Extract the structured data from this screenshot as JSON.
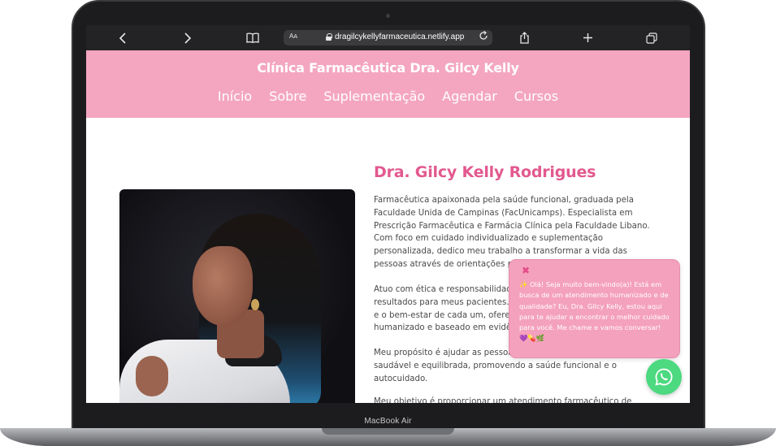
{
  "browser": {
    "text_size_label": "AA",
    "url": "dragilcykellyfarmaceutica.netlify.app"
  },
  "site": {
    "title": "Clínica Farmacêutica Dra. Gilcy Kelly",
    "nav": [
      "Início",
      "Sobre",
      "Suplementação",
      "Agendar",
      "Cursos"
    ],
    "accent_color": "#f4a6c0",
    "heading_color": "#e2598f"
  },
  "about": {
    "name": "Dra. Gilcy Kelly Rodrigues",
    "paragraphs": [
      "Farmacêutica apaixonada pela saúde funcional, graduada pela Faculdade Unida de Campinas (FacUnicamps). Especialista em Prescrição Farmacêutica e Farmácia Clínica pela Faculdade Libano. Com foco em cuidado individualizado e suplementação personalizada, dedico meu trabalho a transformar a vida das pessoas através de orientações personalizadas.",
      "Atuo com ética e responsabilidade, buscando os melhores resultados para meus pacientes. Meu compromisso é com a saúde e o bem-estar de cada um, oferecendo um atendimento humanizado e baseado em evidências científicas.",
      "Meu propósito é ajudar as pessoas a alcançarem uma vida mais saudável e equilibrada, promovendo a saúde funcional e o autocuidado.",
      "Meu objetivo é proporcionar um atendimento farmacêutico de"
    ]
  },
  "chat_popup": {
    "close_symbol": "✖",
    "message": "✨ Olá! Seja muito bem-vindo(a)! Está em busca de um atendimento humanizado e de qualidade? Eu, Dra. Gilcy Kelly, estou aqui para te ajudar a encontrar o melhor cuidado para você. Me chame e vamos conversar! 💜💊🌿"
  },
  "whatsapp_button": {
    "icon": "whatsapp-icon",
    "color": "#4cd980"
  },
  "device": {
    "label": "MacBook Air"
  }
}
